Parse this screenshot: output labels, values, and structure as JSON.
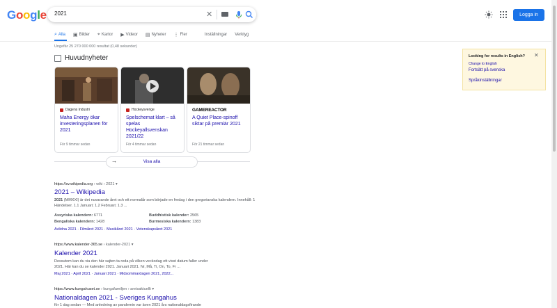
{
  "logo": [
    "G",
    "o",
    "o",
    "g",
    "l",
    "e"
  ],
  "logo_colors": [
    "#4285f4",
    "#ea4335",
    "#fbbc05",
    "#4285f4",
    "#34a853",
    "#ea4335"
  ],
  "search": {
    "query": "2021"
  },
  "header": {
    "login": "Logga in"
  },
  "tabs": [
    {
      "label": "Alla",
      "icon": "search-icon"
    },
    {
      "label": "Bilder",
      "icon": "image-icon"
    },
    {
      "label": "Kartor",
      "icon": "map-pin-icon"
    },
    {
      "label": "Videor",
      "icon": "video-icon"
    },
    {
      "label": "Nyheter",
      "icon": "news-icon"
    },
    {
      "label": "Fler",
      "icon": "more-icon"
    }
  ],
  "tools": {
    "settings": "Inställningar",
    "tools": "Verktyg"
  },
  "stats": "Ungefär 25 270 000 000 resultat (0,48 sekunder)",
  "news": {
    "heading": "Huvudnyheter",
    "cards": [
      {
        "source": "Dagens Industri",
        "title": "Maha Energy ökar investeringsplanen för 2021",
        "time": "För 9 timmar sedan"
      },
      {
        "source": "Hockeysverige",
        "title": "Spelschemat klart – så spelas Hockeyallsvenskan 2021/22",
        "time": "För 4 timmar sedan"
      },
      {
        "source": "GAMEREACTOR",
        "title": "A Quiet Place-spinoff siktar på premiär 2021",
        "time": "För 21 timmar sedan"
      }
    ],
    "show_all": "Visa alla"
  },
  "results": [
    {
      "url": "https://sv.wikipedia.org",
      "crumb": " › wiki › 2021",
      "title": "2021 – Wikipedia",
      "snippet_bold": "2021",
      "snippet_rest": " (MMXXI) är det nuvarande året och ett normalår som började en fredag i den gregorianska kalendern. Innehåll: 1 Händelser. 1.1 Januari; 1.2 Februari; 1.3 ...",
      "facts": [
        {
          "k": "Assyriska kalendern:",
          "v": "6771"
        },
        {
          "k": "Buddhistisk kalender:",
          "v": "2565"
        },
        {
          "k": "Bengaliska kalendern:",
          "v": "1428"
        },
        {
          "k": "Burmesiska kalendern:",
          "v": "1383"
        }
      ],
      "links": "Avlidna 2021 · Filmåret 2021 · Musikåret 2021 · Vetenskapsåret 2021"
    },
    {
      "url": "https://www.kalender-365.se",
      "crumb": " › kalender-2021",
      "title": "Kalender 2021",
      "snippet_line1": "Dessutom kan du via den här sajten ta reda på vilken veckodag ett visst datum faller under",
      "snippet_line2": "2021. Här kan du se kalender 2021. Januari 2021. Nr, Må, Ti, On, To, Fr ...",
      "links": "Maj 2021 · April 2021 · Januari 2021 · Midsommardagen 2021, 2022..."
    },
    {
      "url": "https://www.kungahuset.se",
      "crumb": " › kungafamiljen › aretsaktuellt",
      "title": "Nationaldagen 2021 - Sveriges Kungahus",
      "snippet_line1": "för 1 dag sedan — Med anledning av pandemin var även 2021 års nationaldagsfirande"
    }
  ],
  "panel": {
    "question": "Looking for results in English?",
    "change": "Change to English",
    "continue": "Fortsätt på svenska",
    "settings": "Språkinställningar"
  }
}
